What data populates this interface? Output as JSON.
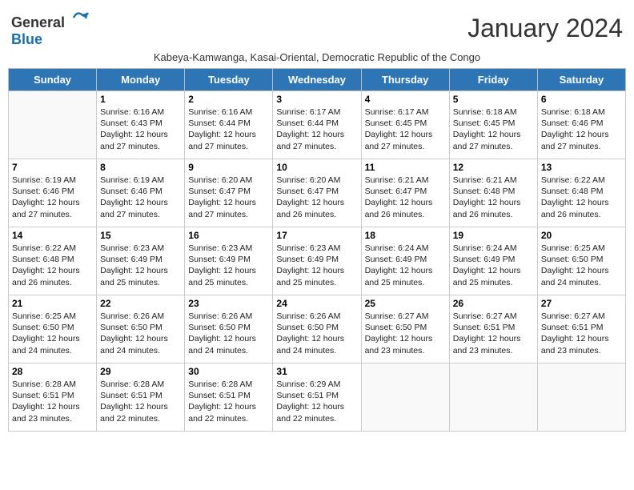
{
  "header": {
    "logo_general": "General",
    "logo_blue": "Blue",
    "title": "January 2024",
    "subtitle": "Kabeya-Kamwanga, Kasai-Oriental, Democratic Republic of the Congo"
  },
  "days_of_week": [
    "Sunday",
    "Monday",
    "Tuesday",
    "Wednesday",
    "Thursday",
    "Friday",
    "Saturday"
  ],
  "weeks": [
    [
      {
        "day": "",
        "info": ""
      },
      {
        "day": "1",
        "info": "Sunrise: 6:16 AM\nSunset: 6:43 PM\nDaylight: 12 hours and 27 minutes."
      },
      {
        "day": "2",
        "info": "Sunrise: 6:16 AM\nSunset: 6:44 PM\nDaylight: 12 hours and 27 minutes."
      },
      {
        "day": "3",
        "info": "Sunrise: 6:17 AM\nSunset: 6:44 PM\nDaylight: 12 hours and 27 minutes."
      },
      {
        "day": "4",
        "info": "Sunrise: 6:17 AM\nSunset: 6:45 PM\nDaylight: 12 hours and 27 minutes."
      },
      {
        "day": "5",
        "info": "Sunrise: 6:18 AM\nSunset: 6:45 PM\nDaylight: 12 hours and 27 minutes."
      },
      {
        "day": "6",
        "info": "Sunrise: 6:18 AM\nSunset: 6:46 PM\nDaylight: 12 hours and 27 minutes."
      }
    ],
    [
      {
        "day": "7",
        "info": "Sunrise: 6:19 AM\nSunset: 6:46 PM\nDaylight: 12 hours and 27 minutes."
      },
      {
        "day": "8",
        "info": "Sunrise: 6:19 AM\nSunset: 6:46 PM\nDaylight: 12 hours and 27 minutes."
      },
      {
        "day": "9",
        "info": "Sunrise: 6:20 AM\nSunset: 6:47 PM\nDaylight: 12 hours and 27 minutes."
      },
      {
        "day": "10",
        "info": "Sunrise: 6:20 AM\nSunset: 6:47 PM\nDaylight: 12 hours and 26 minutes."
      },
      {
        "day": "11",
        "info": "Sunrise: 6:21 AM\nSunset: 6:47 PM\nDaylight: 12 hours and 26 minutes."
      },
      {
        "day": "12",
        "info": "Sunrise: 6:21 AM\nSunset: 6:48 PM\nDaylight: 12 hours and 26 minutes."
      },
      {
        "day": "13",
        "info": "Sunrise: 6:22 AM\nSunset: 6:48 PM\nDaylight: 12 hours and 26 minutes."
      }
    ],
    [
      {
        "day": "14",
        "info": "Sunrise: 6:22 AM\nSunset: 6:48 PM\nDaylight: 12 hours and 26 minutes."
      },
      {
        "day": "15",
        "info": "Sunrise: 6:23 AM\nSunset: 6:49 PM\nDaylight: 12 hours and 25 minutes."
      },
      {
        "day": "16",
        "info": "Sunrise: 6:23 AM\nSunset: 6:49 PM\nDaylight: 12 hours and 25 minutes."
      },
      {
        "day": "17",
        "info": "Sunrise: 6:23 AM\nSunset: 6:49 PM\nDaylight: 12 hours and 25 minutes."
      },
      {
        "day": "18",
        "info": "Sunrise: 6:24 AM\nSunset: 6:49 PM\nDaylight: 12 hours and 25 minutes."
      },
      {
        "day": "19",
        "info": "Sunrise: 6:24 AM\nSunset: 6:49 PM\nDaylight: 12 hours and 25 minutes."
      },
      {
        "day": "20",
        "info": "Sunrise: 6:25 AM\nSunset: 6:50 PM\nDaylight: 12 hours and 24 minutes."
      }
    ],
    [
      {
        "day": "21",
        "info": "Sunrise: 6:25 AM\nSunset: 6:50 PM\nDaylight: 12 hours and 24 minutes."
      },
      {
        "day": "22",
        "info": "Sunrise: 6:26 AM\nSunset: 6:50 PM\nDaylight: 12 hours and 24 minutes."
      },
      {
        "day": "23",
        "info": "Sunrise: 6:26 AM\nSunset: 6:50 PM\nDaylight: 12 hours and 24 minutes."
      },
      {
        "day": "24",
        "info": "Sunrise: 6:26 AM\nSunset: 6:50 PM\nDaylight: 12 hours and 24 minutes."
      },
      {
        "day": "25",
        "info": "Sunrise: 6:27 AM\nSunset: 6:50 PM\nDaylight: 12 hours and 23 minutes."
      },
      {
        "day": "26",
        "info": "Sunrise: 6:27 AM\nSunset: 6:51 PM\nDaylight: 12 hours and 23 minutes."
      },
      {
        "day": "27",
        "info": "Sunrise: 6:27 AM\nSunset: 6:51 PM\nDaylight: 12 hours and 23 minutes."
      }
    ],
    [
      {
        "day": "28",
        "info": "Sunrise: 6:28 AM\nSunset: 6:51 PM\nDaylight: 12 hours and 23 minutes."
      },
      {
        "day": "29",
        "info": "Sunrise: 6:28 AM\nSunset: 6:51 PM\nDaylight: 12 hours and 22 minutes."
      },
      {
        "day": "30",
        "info": "Sunrise: 6:28 AM\nSunset: 6:51 PM\nDaylight: 12 hours and 22 minutes."
      },
      {
        "day": "31",
        "info": "Sunrise: 6:29 AM\nSunset: 6:51 PM\nDaylight: 12 hours and 22 minutes."
      },
      {
        "day": "",
        "info": ""
      },
      {
        "day": "",
        "info": ""
      },
      {
        "day": "",
        "info": ""
      }
    ]
  ]
}
